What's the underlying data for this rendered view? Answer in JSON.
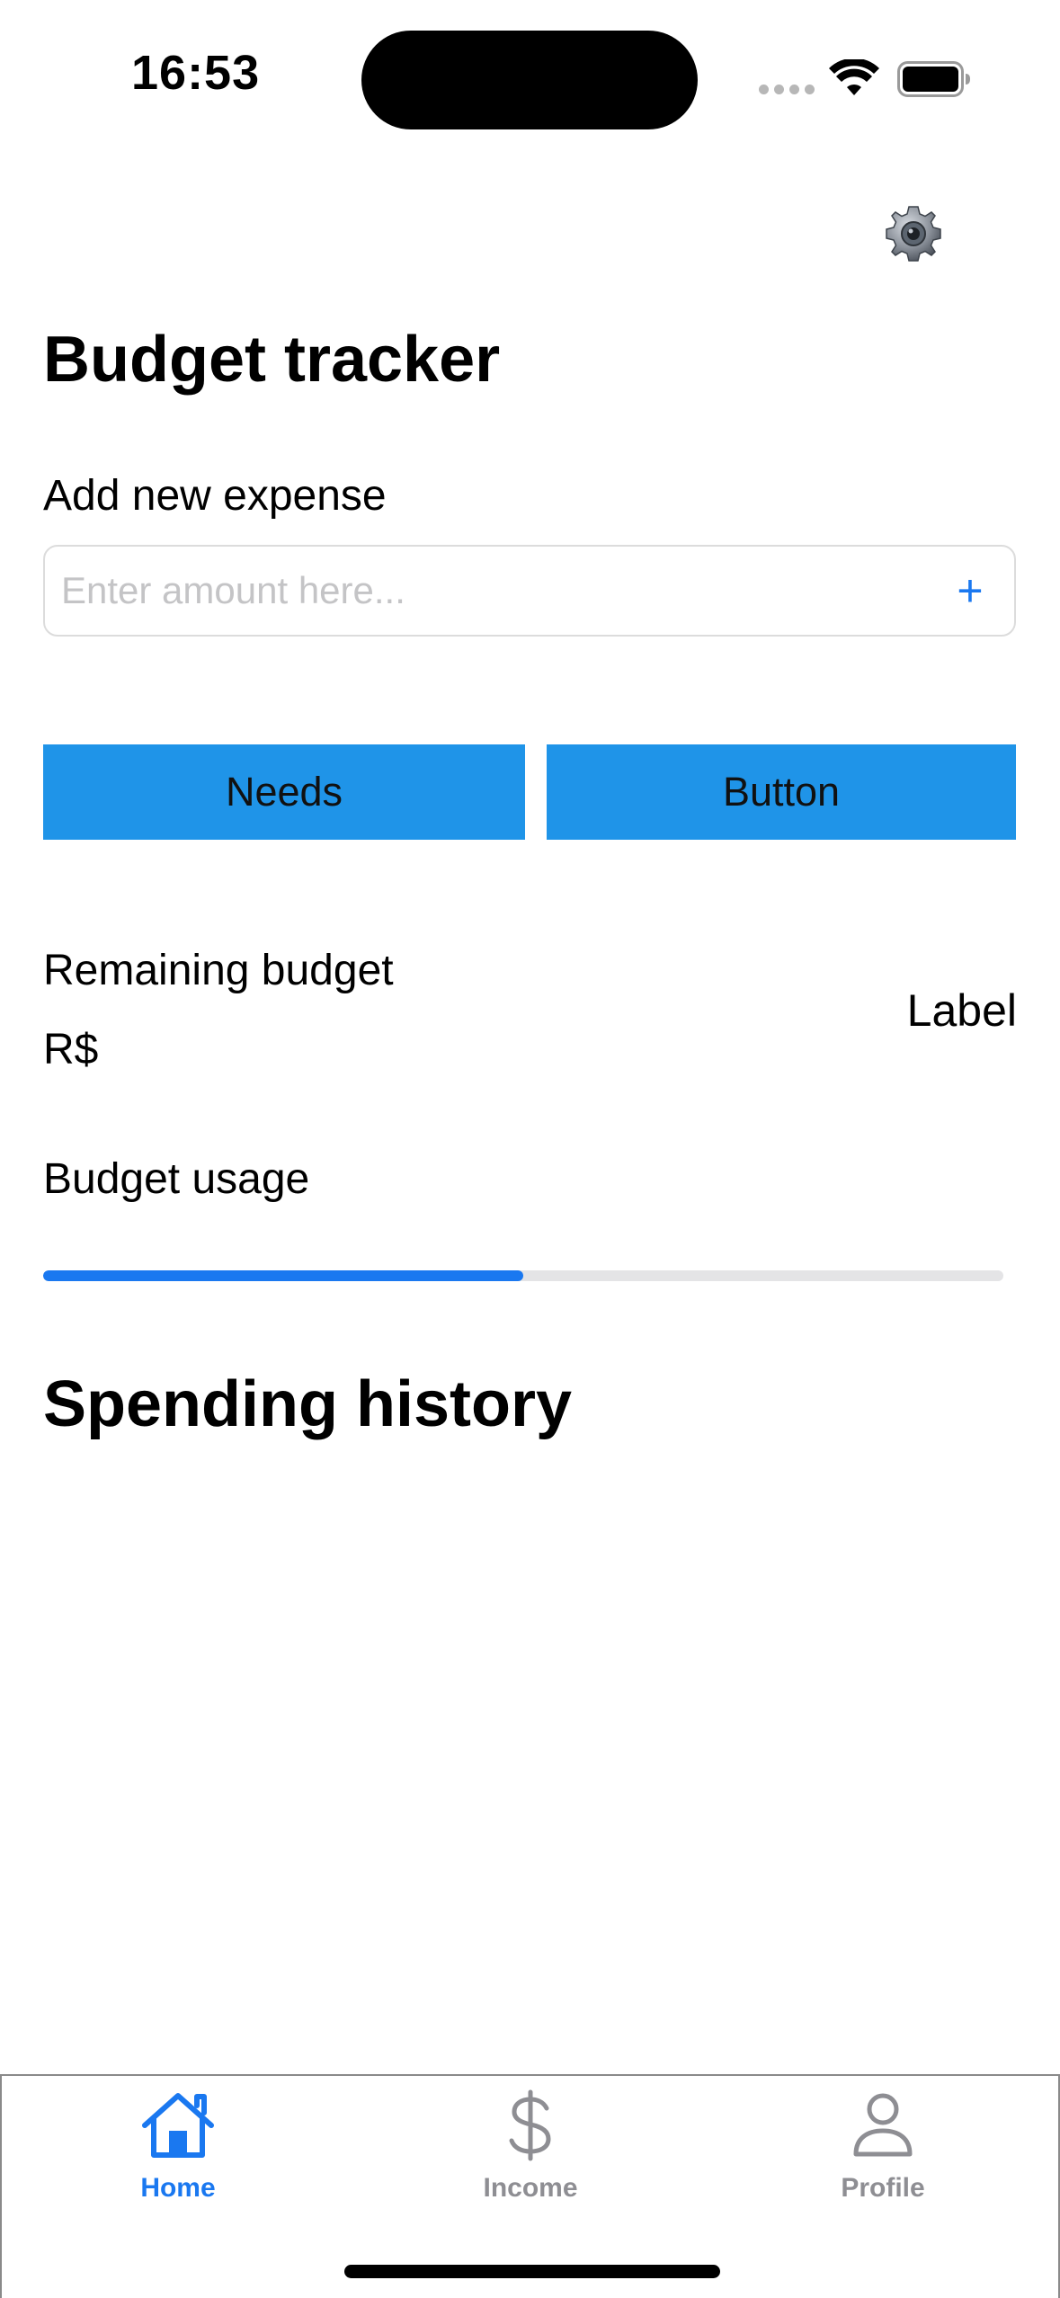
{
  "status_bar": {
    "time": "16:53"
  },
  "header": {
    "settings_icon": "gear-icon",
    "title": "Budget tracker"
  },
  "expense": {
    "label": "Add new expense",
    "value": "",
    "placeholder": "Enter amount here...",
    "add_label": "+"
  },
  "categories": {
    "needs_label": "Needs",
    "second_label": "Button"
  },
  "remaining": {
    "label": "Remaining budget",
    "currency": "R$",
    "value_label": "Label"
  },
  "usage": {
    "label": "Budget usage",
    "progress": 0.5
  },
  "history": {
    "title": "Spending history"
  },
  "tab_bar": {
    "items": [
      {
        "label": "Home",
        "icon": "home-icon",
        "active": true
      },
      {
        "label": "Income",
        "icon": "dollar-icon",
        "active": false
      },
      {
        "label": "Profile",
        "icon": "person-icon",
        "active": false
      }
    ]
  },
  "colors": {
    "accent": "#1a78f0",
    "button_fill": "#1f94e8",
    "inactive_tab": "#8e8e93"
  }
}
